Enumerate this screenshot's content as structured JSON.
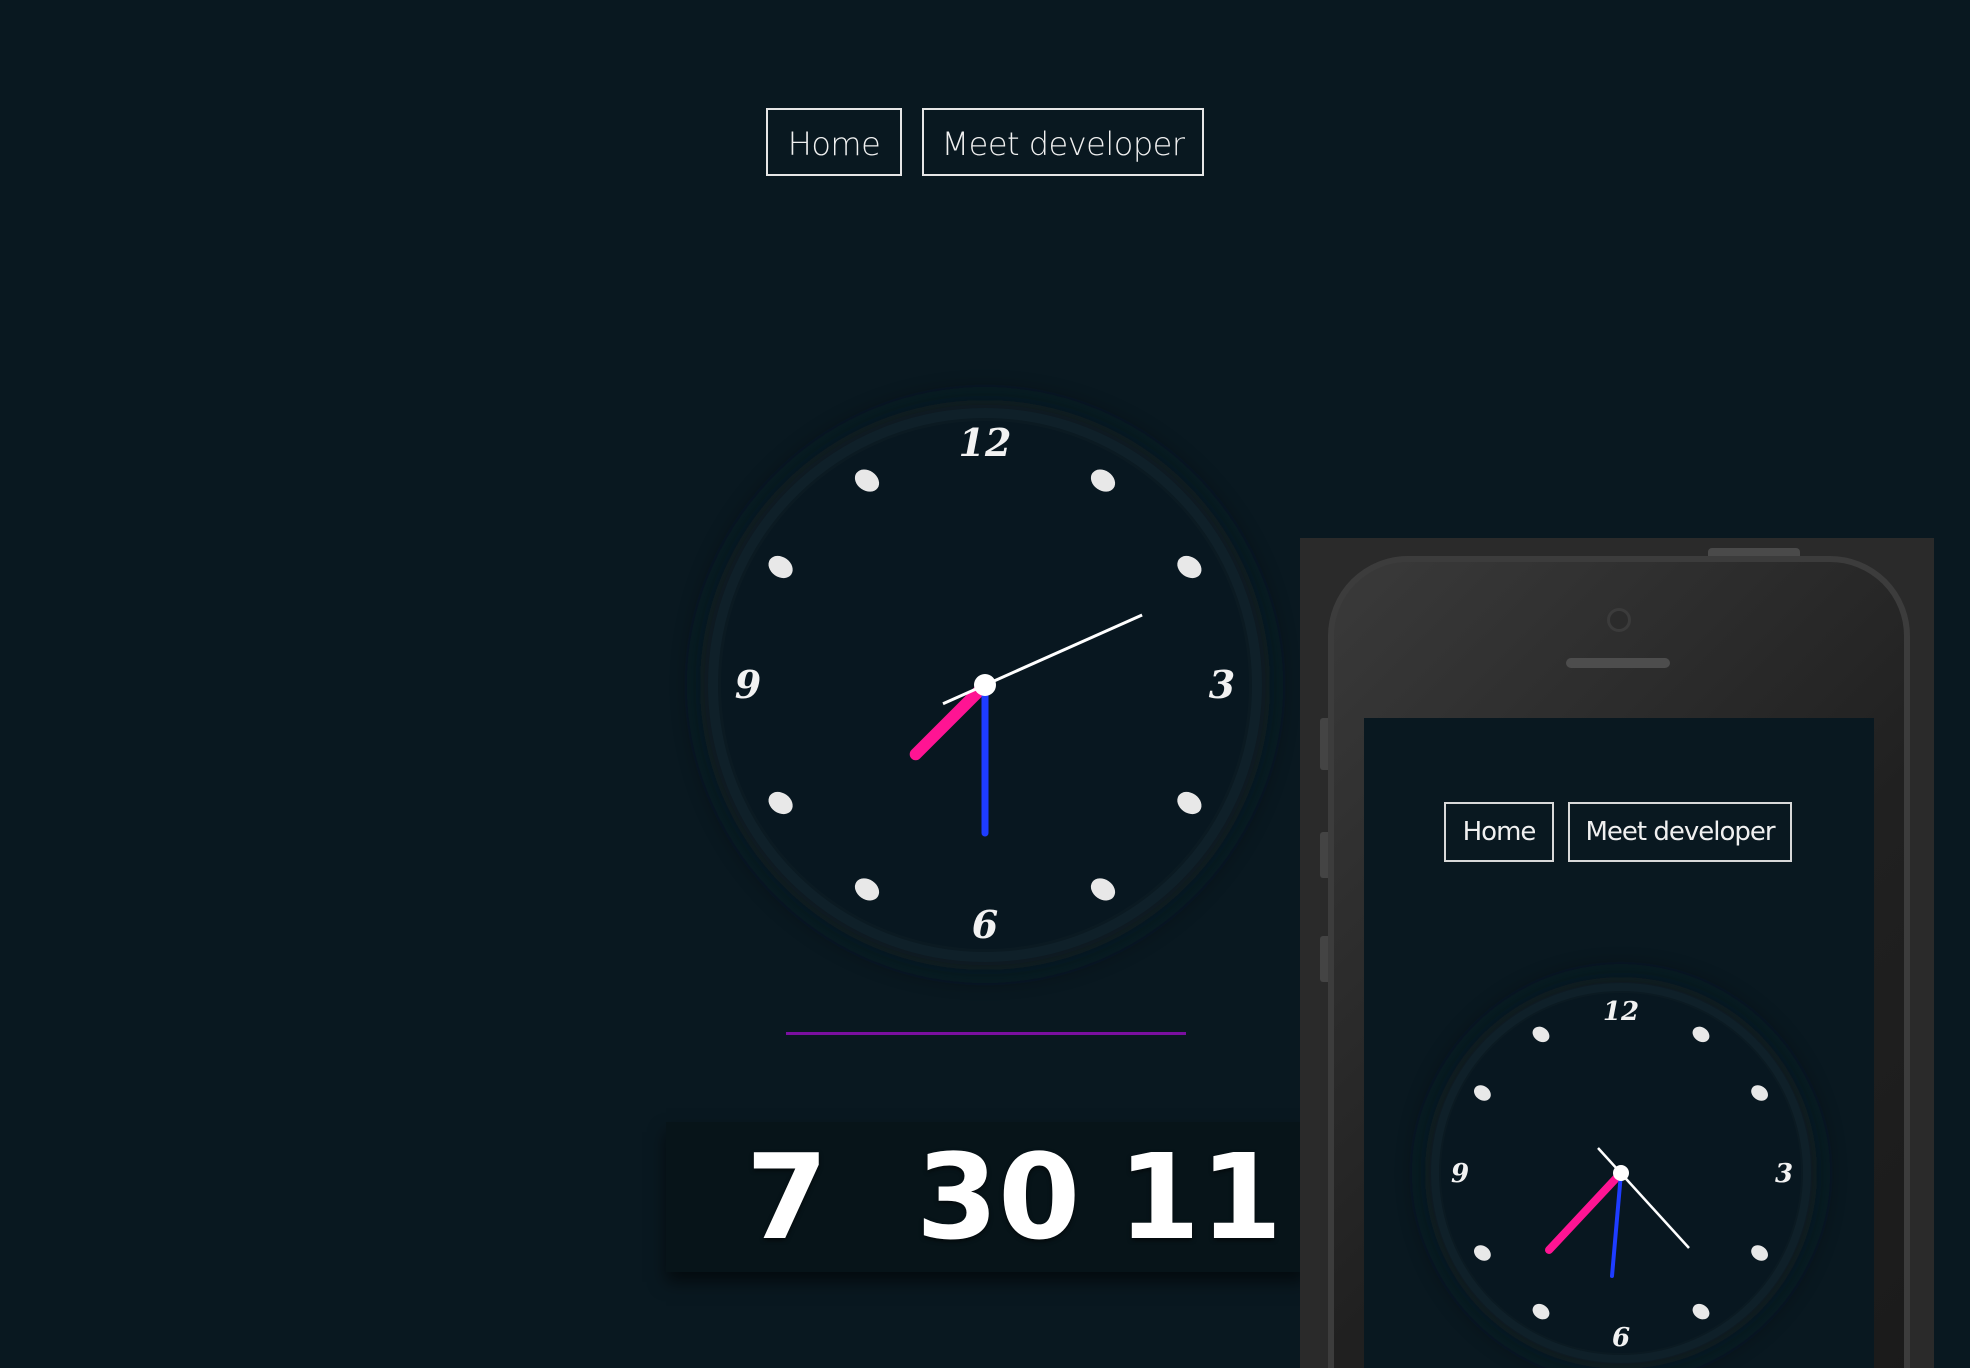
{
  "nav": {
    "home_label": "Home",
    "developer_label": "Meet developer"
  },
  "clock": {
    "numerals": {
      "twelve": "12",
      "three": "3",
      "six": "6",
      "nine": "9"
    },
    "time": {
      "hour": 7,
      "minute": 30,
      "second": 11
    },
    "colors": {
      "hour_hand": "#ff1493",
      "minute_hand": "#1e3cff",
      "second_hand": "#ffffff",
      "divider": "#7a0fa0"
    }
  },
  "digital": {
    "hour": "7",
    "minute": "30",
    "second": "11"
  },
  "phone_preview": {
    "nav": {
      "home_label": "Home",
      "developer_label": "Meet developer"
    },
    "numerals": {
      "twelve": "12",
      "three": "3",
      "six": "6",
      "nine": "9"
    }
  }
}
